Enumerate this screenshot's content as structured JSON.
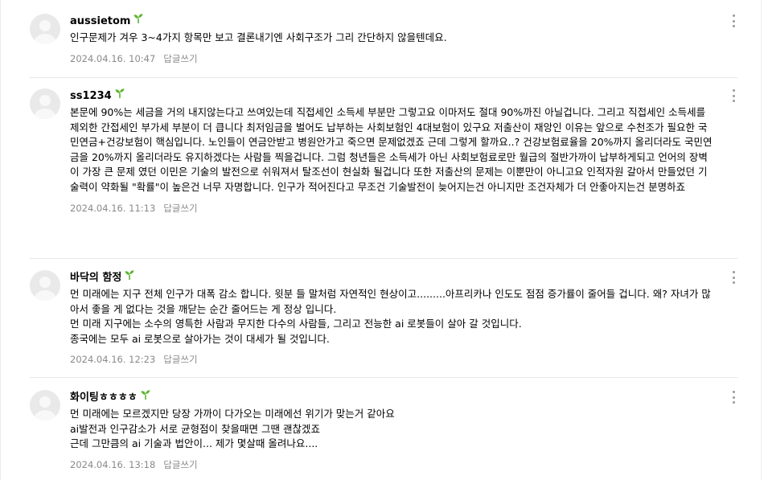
{
  "comments": [
    {
      "nickname": "aussietom",
      "lines": [
        "인구문제가 겨우 3~4가지 항목만 보고 결론내기엔 사회구조가 그리 간단하지 않을텐데요."
      ],
      "date": "2024.04.16. 10:47",
      "reply_label": "답글쓰기"
    },
    {
      "nickname": "ss1234",
      "lines": [
        "본문에 90%는 세금을 거의 내지않는다고 쓰여있는데 직접세인 소득세 부분만 그렇고요 이마저도 절대 90%까진 아닐겁니다. 그리고 직접세인 소득세를 제외한 간접세인 부가세 부분이 더 큽니다 최저임금을 벌어도 납부하는 사회보험인 4대보험이 있구요 저출산이 재앙인 이유는 앞으로 수천조가 필요한 국민연금+건강보험이 핵심입니다. 노인들이 연금안받고 병원안가고 죽으면 문제없겠죠 근데 그렇게 할까요..? 건강보험료율을 20%까지 올리더라도 국민연금을 20%까지 올리더라도 유지하겠다는 사람들 찍을겁니다. 그럼 청년들은 소득세가 아닌 사회보험료로만 월급의 절반가까이 납부하게되고 언어의 장벽이 가장 큰 문제 였던 이민은 기술의 발전으로 쉬워져서 탈조선이 현실화 될겁니다 또한 저출산의 문제는 이뿐만이 아니고요 인적자원 갈아서 만들었던 기술력이 약화될 \"확률\"이 높은건 너무 자명합니다. 인구가 적어진다고 무조건 기술발전이 늦어지는건 아니지만 조건자체가 더 안좋아지는건 분명하죠"
      ],
      "date": "2024.04.16. 11:13",
      "reply_label": "답글쓰기"
    },
    {
      "nickname": "바닥의 함정",
      "lines": [
        "먼 미래에는 지구 전체 인구가 대폭 감소 합니다. 윗분 들 말처럼 자연적인 현상이고.........아프리카나 인도도 점점 증가률이 줄어들 겁니다. 왜? 자녀가 많아서 좋을 게 없다는 것을 깨닫는 순간 줄어드는 게 정상 입니다.",
        "먼 미래 지구에는 소수의 영특한 사람과 무지한 다수의 사람들, 그리고 전능한 ai 로봇들이 살아 갈 것입니다.",
        "종국에는 모두 ai 로봇으로 살아가는 것이 대세가 될 것입니다."
      ],
      "date": "2024.04.16. 12:23",
      "reply_label": "답글쓰기"
    },
    {
      "nickname": "화이팅ㅎㅎㅎㅎ",
      "lines": [
        "먼 미래에는 모르겠지만 당장 가까이 다가오는 미래에선 위기가 맞는거 같아요",
        "ai발전과 인구감소가 서로 균형점이 찾을때면 그땐 괜찮겠죠",
        "근데 그만큼의 ai 기술과 법안이... 제가 몇살때 올려나요...."
      ],
      "date": "2024.04.16. 13:18",
      "reply_label": "답글쓰기"
    }
  ]
}
